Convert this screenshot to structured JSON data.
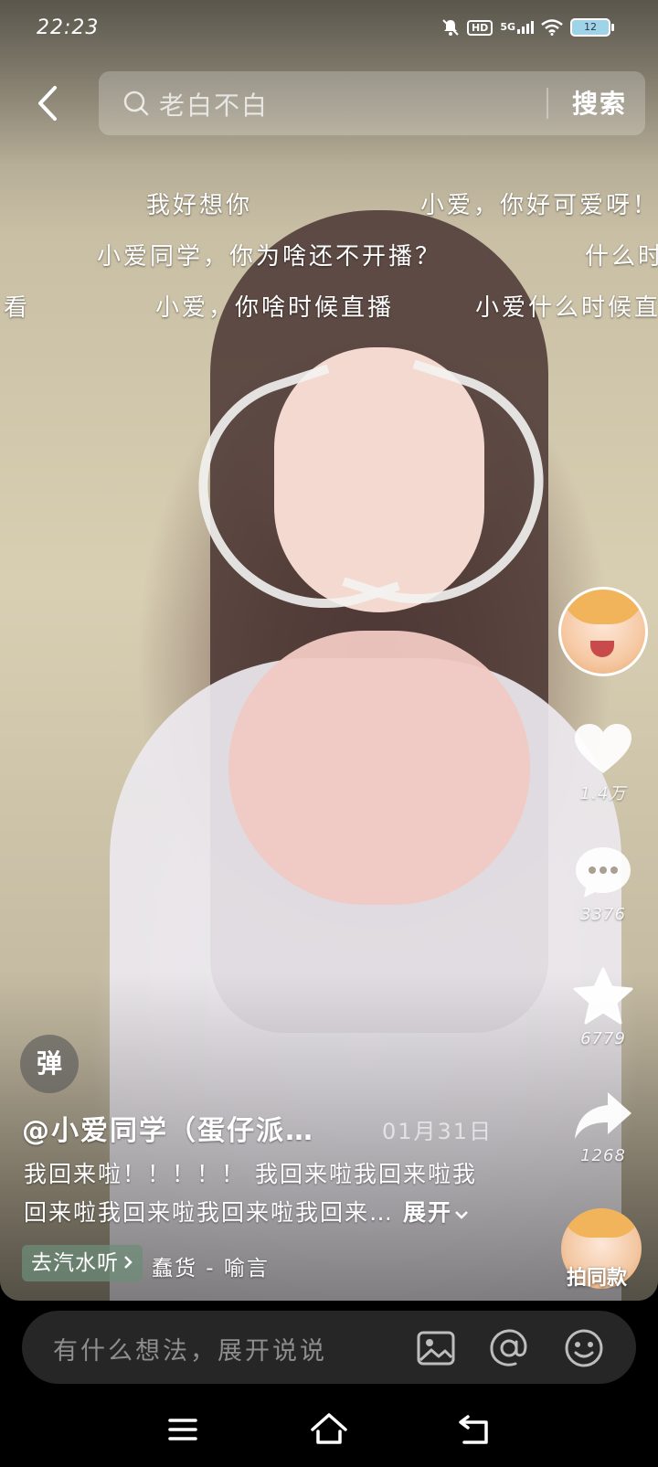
{
  "status_bar": {
    "time": "22:23",
    "network": "5G",
    "hd_label": "HD",
    "battery": "12",
    "icons": [
      "mute-bell-icon",
      "hd-icon",
      "signal-icon",
      "wifi-icon",
      "battery-icon"
    ]
  },
  "search": {
    "placeholder": "老白不白",
    "button": "搜索"
  },
  "danmaku": [
    "我好想你",
    "小爱，你好可爱呀！",
    "小爱同学，你为啥还不开播？",
    "什么时",
    "看",
    "小爱，你啥时候直播",
    "小爱什么时候直"
  ],
  "actions": {
    "likes": "1.4万",
    "comments": "3376",
    "favorites": "6779",
    "shares": "1268",
    "same_style": "拍同款"
  },
  "post": {
    "danmaku_toggle": "弹",
    "author": "@小爱同学（蛋仔派…",
    "date": "01月31日",
    "description": "我回来啦！！！！！ 我回来啦我回来啦我回来啦我回来啦我回来啦我回来…",
    "expand": "展开",
    "music_chip": "去汽水听",
    "music_title": "蠢货 - 喻言"
  },
  "comment_bar": {
    "placeholder": "有什么想法，展开说说"
  },
  "colors": {
    "background": "#000000",
    "comment_bar": "#262626",
    "music_chip": "#6e8c78"
  }
}
